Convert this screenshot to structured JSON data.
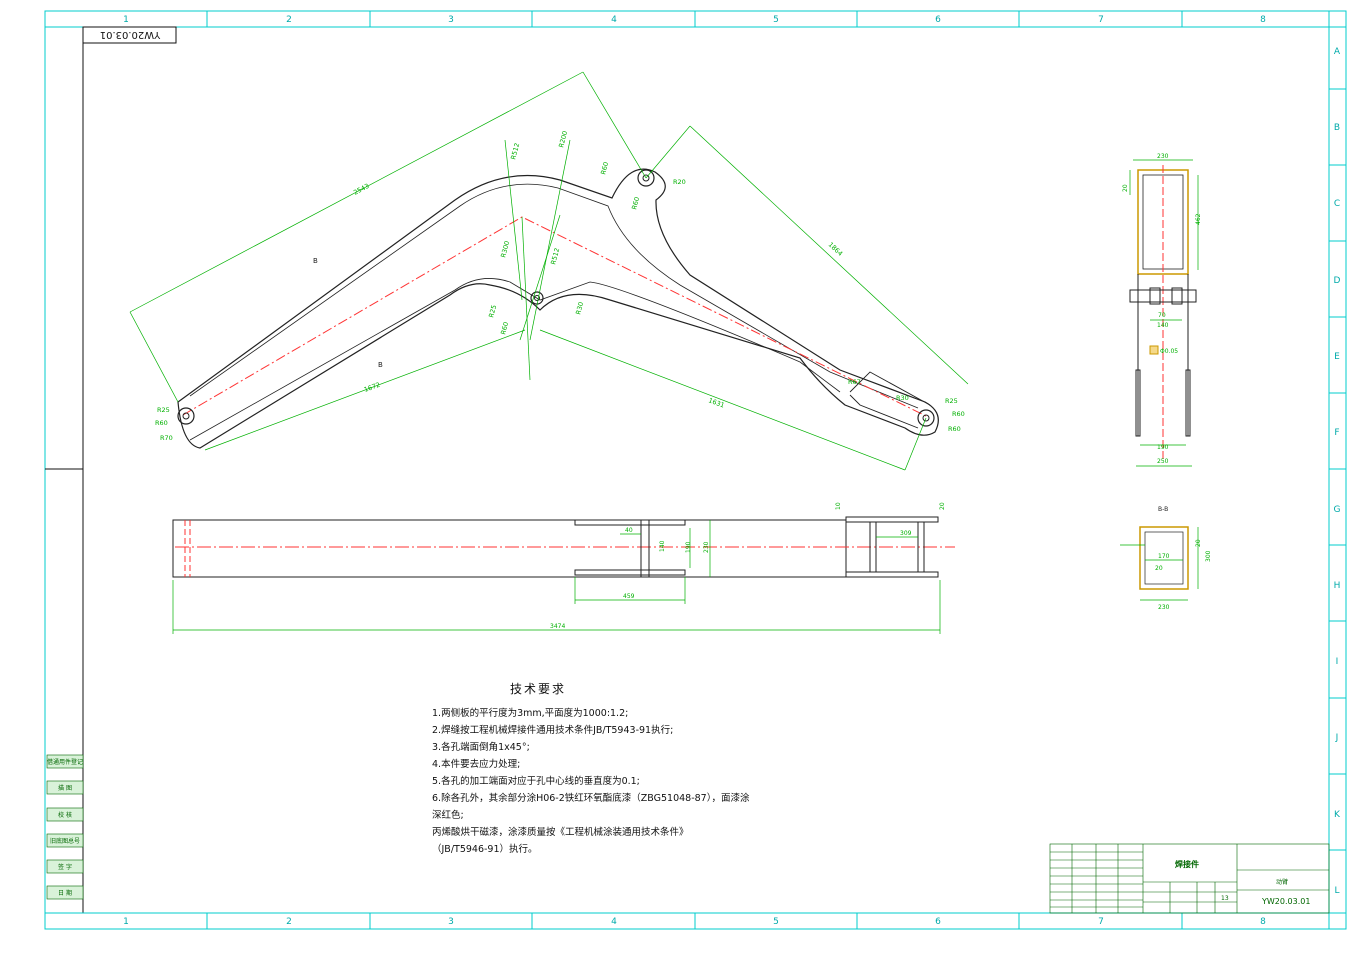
{
  "drawing_number": "YW20.03.01",
  "zone_columns": [
    "1",
    "2",
    "3",
    "4",
    "5",
    "6",
    "7",
    "8"
  ],
  "zone_rows": [
    "A",
    "B",
    "C",
    "D",
    "E",
    "F",
    "G",
    "H",
    "I",
    "J",
    "K",
    "L"
  ],
  "side_labels": [
    "借通用件登记",
    "描 图",
    "校 核",
    "旧底图总号",
    "签 字",
    "日 期"
  ],
  "title_block": {
    "part_name": "焊接件",
    "assembly_name": "动臂",
    "drawing_no": "YW20.03.01",
    "sheet_count": "13"
  },
  "dimensions": {
    "arm_upper_len": "2543",
    "arm_right_len": "1864",
    "arm_lower_left": "1672",
    "arm_lower_right": "1631",
    "plan_total": "3474",
    "plan_pad": "459",
    "plan_right": "309",
    "plan_w1": "190",
    "plan_w2": "230",
    "plan_small": "40",
    "plan_t1": "10",
    "plan_t2": "20",
    "sec_top": "230",
    "sec_h": "462",
    "sec_t": "20",
    "sec_inner": "140",
    "sec_pin": "70",
    "sec_bore": "Φ0.05",
    "sec_bottom1": "190",
    "sec_bottom2": "250",
    "bb_w": "170",
    "bb_t": "20",
    "bb_h": "300",
    "bb_out": "230",
    "bb_side": "20"
  },
  "radii": [
    "R25",
    "R60",
    "R70",
    "R20",
    "R60",
    "R60",
    "R30",
    "R25",
    "R60",
    "R60",
    "R25",
    "R60",
    "R67",
    "R30",
    "R512",
    "R30",
    "R200",
    "R512",
    "R25",
    "R60",
    "R300",
    "R30"
  ],
  "labels": {
    "section_mark": "B",
    "section_title": "B-B"
  },
  "notes": {
    "title": "技术要求",
    "lines": [
      "1.两侧板的平行度为3mm,平面度为1000:1.2;",
      "2.焊缝按工程机械焊接件通用技术条件JB/T5943-91执行;",
      "3.各孔端面倒角1x45°;",
      "4.本件要去应力处理;",
      "5.各孔的加工端面对应于孔中心线的垂直度为0.1;",
      "6.除各孔外，其余部分涂H06-2铁红环氧酯底漆（ZBG51048-87），面漆涂",
      "  深红色;",
      "  丙烯酸烘干磁漆，涂漆质量按《工程机械涂装通用技术条件》",
      "  （JB/T5946-91）执行。"
    ]
  },
  "colors": {
    "frame": "#00cccc",
    "outline": "#222222",
    "dimension": "#00b000",
    "centerline": "#ff3333",
    "section": "#cc9900"
  }
}
